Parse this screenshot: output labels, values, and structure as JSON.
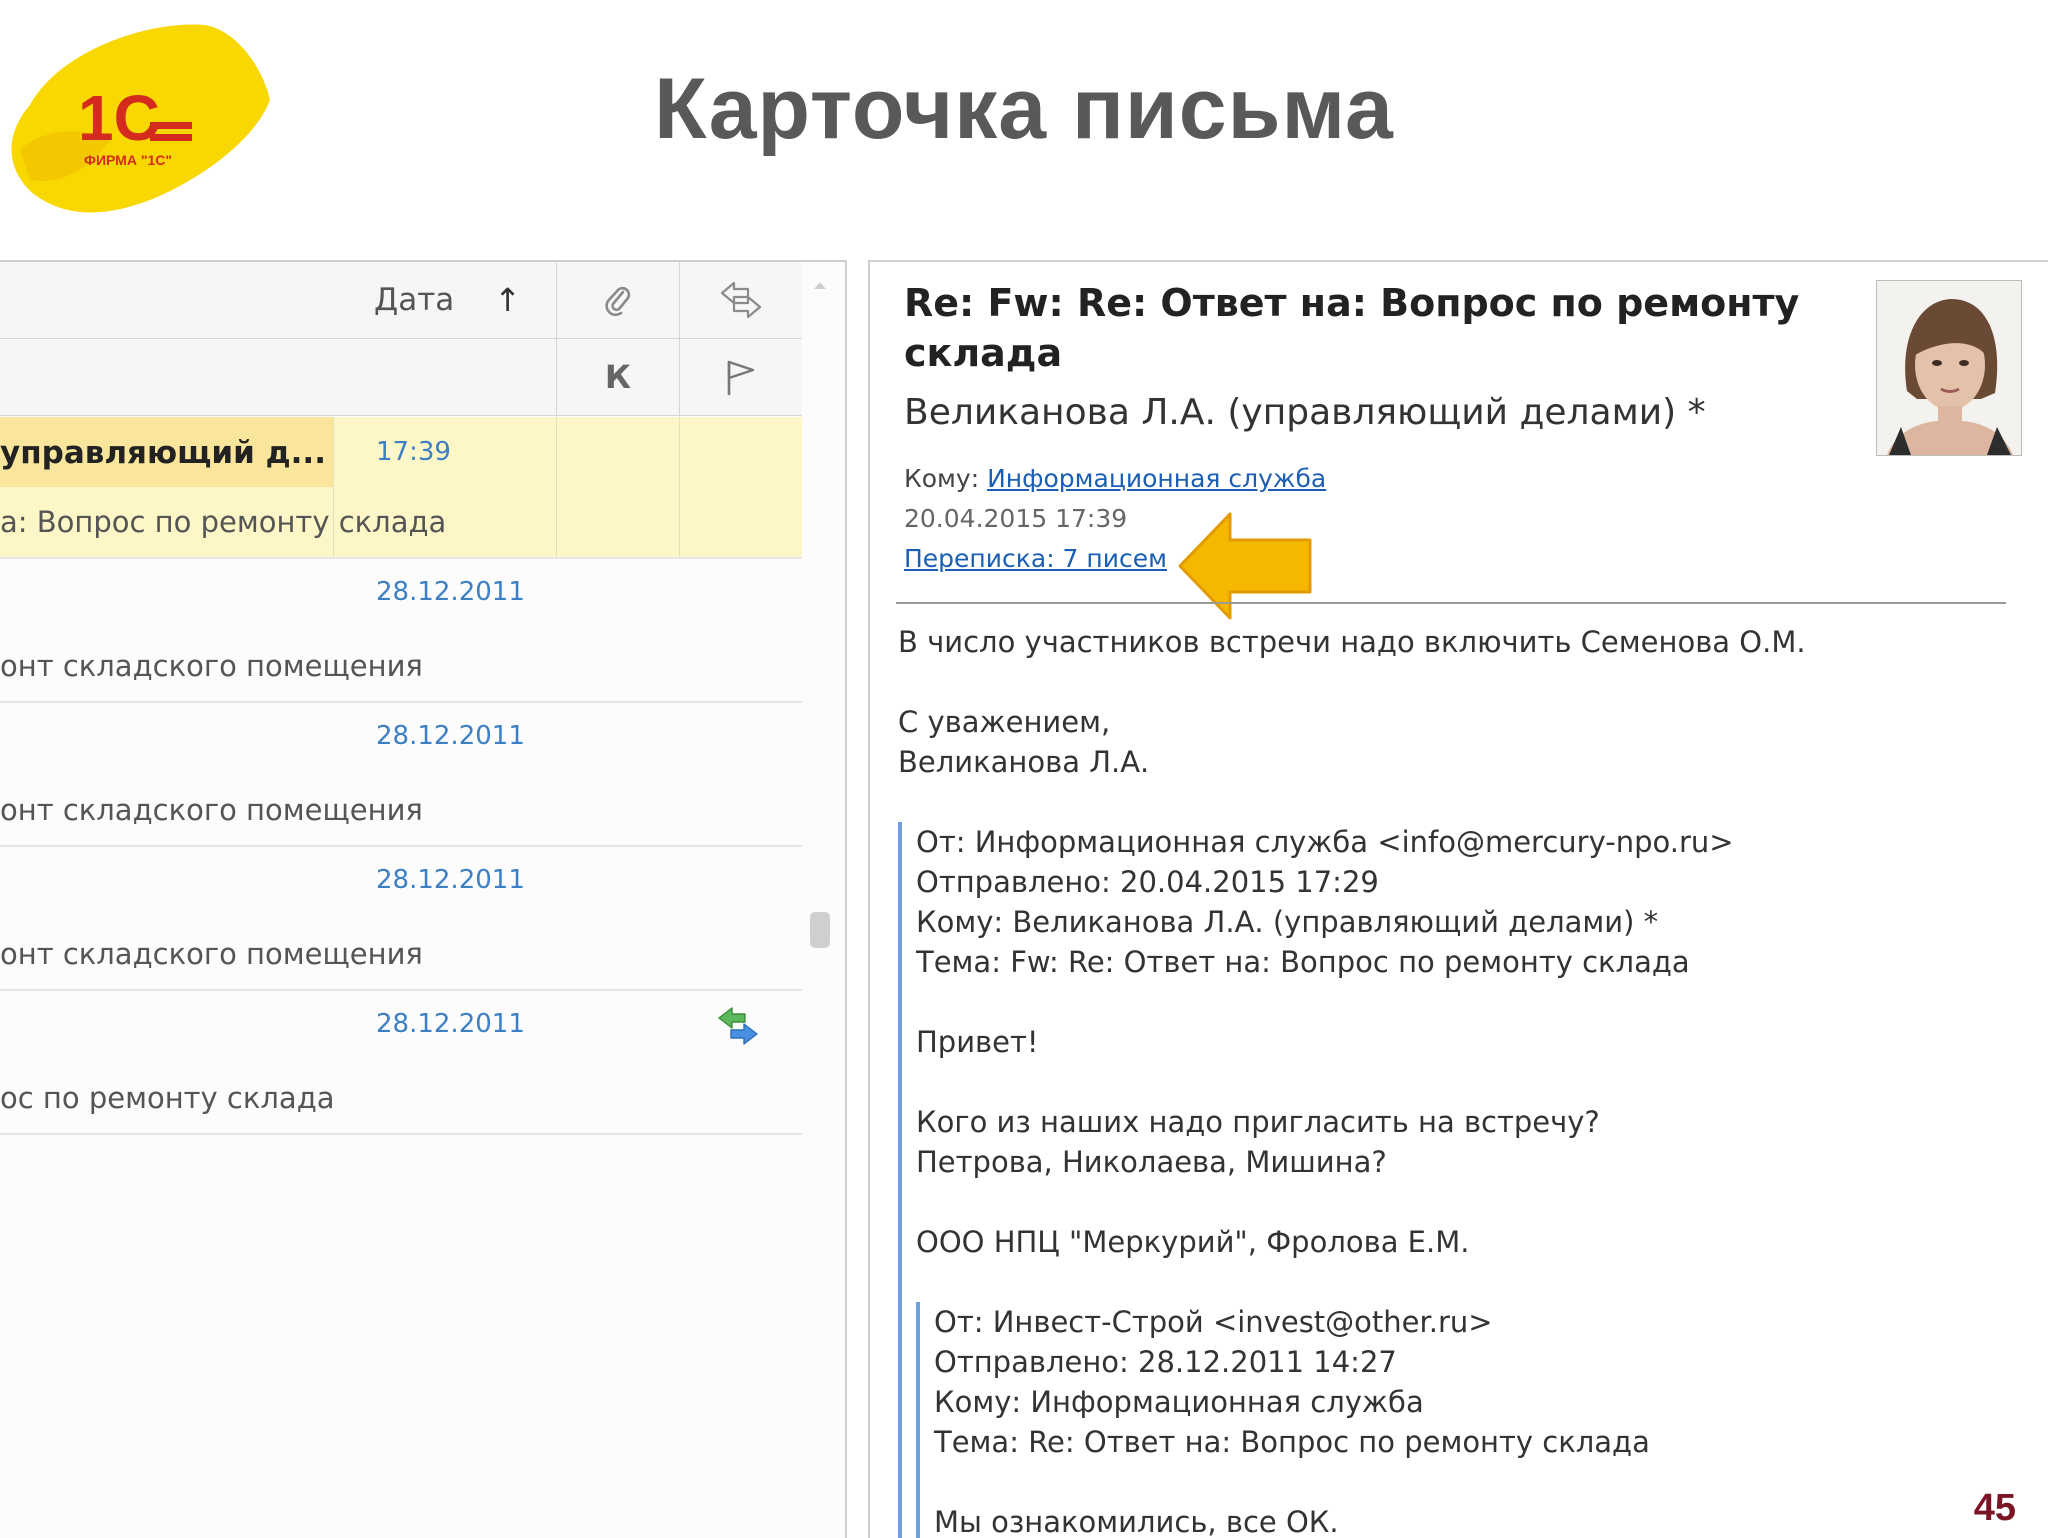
{
  "slide": {
    "title": "Карточка письма",
    "page_number": "45",
    "logo_text": "1С",
    "logo_subtext": "ФИРМА \"1С\""
  },
  "list": {
    "columns": {
      "date_label": "Дата",
      "sort_icon": "sort-ascending-arrow",
      "attachment_icon": "paperclip",
      "forward_icon": "forward-arrows",
      "k_label": "К",
      "flag_icon": "flag"
    },
    "messages": [
      {
        "sender": "управляющий д...",
        "date": "17:39",
        "subject": "а: Вопрос по ремонту склада",
        "selected": true,
        "forwarded": false
      },
      {
        "sender": "",
        "date": "28.12.2011",
        "subject": "онт складского помещения",
        "selected": false,
        "forwarded": false
      },
      {
        "sender": "",
        "date": "28.12.2011",
        "subject": "онт складского помещения",
        "selected": false,
        "forwarded": false
      },
      {
        "sender": "",
        "date": "28.12.2011",
        "subject": "онт складского помещения",
        "selected": false,
        "forwarded": false
      },
      {
        "sender": "",
        "date": "28.12.2011",
        "subject": "ос по ремонту склада",
        "selected": false,
        "forwarded": true
      }
    ]
  },
  "reader": {
    "subject": "Re: Fw: Re: Ответ на: Вопрос по ремонту склада",
    "from": "Великанова Л.А. (управляющий делами) *",
    "to_label": "Кому:",
    "to_value": "Информационная служба",
    "date": "20.04.2015 17:39",
    "thread_link": "Переписка: 7 писем",
    "body": {
      "line1": "В число участников встречи надо включить Семенова О.М.",
      "regards": "С уважением,",
      "signature": "Великанова Л.А.",
      "quote1": {
        "from": "От: Информационная служба <info@mercury-npo.ru>",
        "sent": "Отправлено: 20.04.2015 17:29",
        "to": "Кому: Великанова Л.А. (управляющий делами) *",
        "subject": "Тема: Fw: Re: Ответ на: Вопрос по ремонту склада",
        "greeting": "Привет!",
        "question": "Кого из наших надо пригласить на встречу?",
        "names": "Петрова, Николаева, Мишина?",
        "company": "ООО НПЦ \"Меркурий\", Фролова Е.М."
      },
      "quote2": {
        "from": "От: Инвест-Строй <invest@other.ru>",
        "sent": "Отправлено: 28.12.2011 14:27",
        "to": "Кому: Информационная служба",
        "subject": "Тема: Re: Ответ на: Вопрос по ремонту склада",
        "text": "Мы ознакомились, все ОК."
      }
    },
    "callout_color": "#f5b800"
  },
  "colors": {
    "selected_row": "#fdf6c7",
    "selected_sender_cell": "#f9e59c",
    "date_blue": "#3c7fc4",
    "link_blue": "#1a5fb4",
    "quote_bar": "#6f9fd8",
    "logo_yellow": "#f8d800",
    "logo_red": "#d52b1e"
  }
}
